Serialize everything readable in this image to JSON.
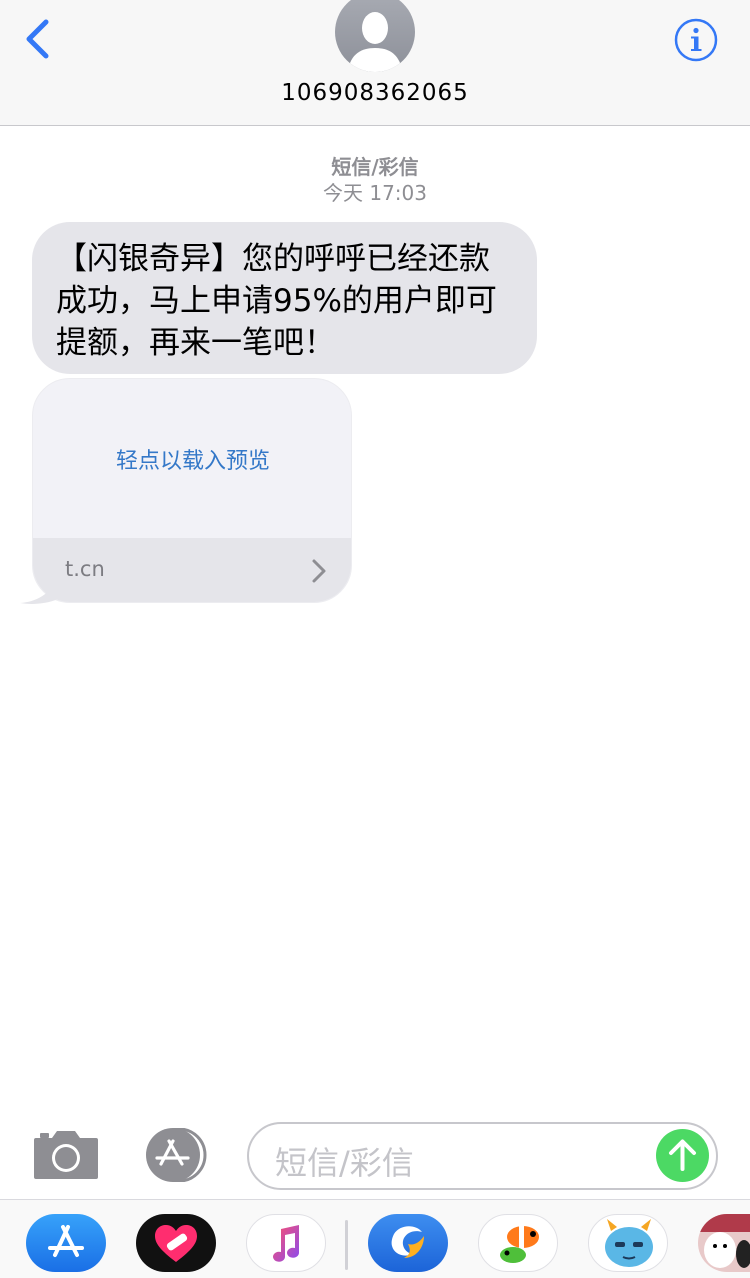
{
  "header": {
    "contact_number": "106908362065"
  },
  "conversation": {
    "message_type": "短信/彩信",
    "timestamp": "今天 17:03",
    "message_text": "【闪银奇异】您的呼呼已经还款成功，马上申请95%的用户即可提额，再来一笔吧！",
    "link_preview": {
      "tap_text": "轻点以载入预览",
      "domain": "t.cn"
    }
  },
  "input_bar": {
    "placeholder": "短信/彩信"
  },
  "app_drawer": {
    "apps": [
      "app-store-icon",
      "digital-touch-icon",
      "music-icon",
      "ctrip-icon",
      "clownfish-sticker-icon",
      "monster-sticker-icon",
      "cat-sticker-icon"
    ]
  },
  "colors": {
    "accent_blue": "#3478f6",
    "bubble_gray": "#e5e5ea",
    "send_green": "#4cd964",
    "link_blue": "#3478c8"
  }
}
